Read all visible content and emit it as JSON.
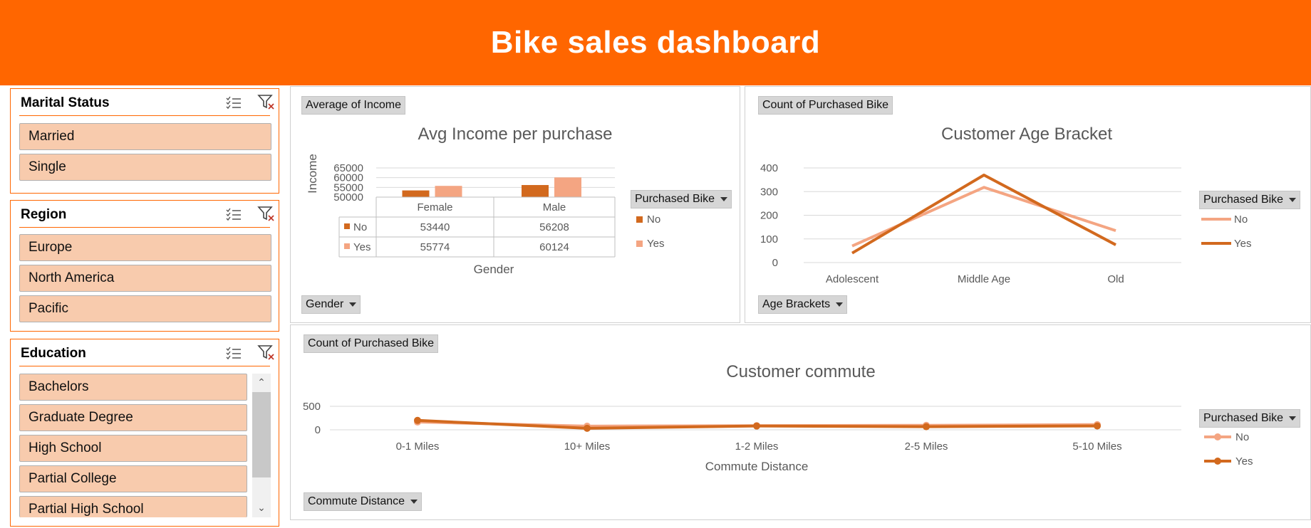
{
  "header": {
    "title": "Bike sales dashboard"
  },
  "colors": {
    "header": "#ff6600",
    "no": "#d2691e",
    "yes": "#f4a582",
    "slicer_item": "#f8cbad"
  },
  "slicers": [
    {
      "title": "Marital Status",
      "items": [
        "Married",
        "Single"
      ]
    },
    {
      "title": "Region",
      "items": [
        "Europe",
        "North America",
        "Pacific"
      ]
    },
    {
      "title": "Education",
      "items": [
        "Bachelors",
        "Graduate Degree",
        "High School",
        "Partial College",
        "Partial High School"
      ]
    }
  ],
  "income_panel": {
    "value_button": "Average of Income",
    "axis_button": "Gender",
    "legend_button": "Purchased Bike",
    "legend": [
      "No",
      "Yes"
    ],
    "table": {
      "headers": [
        "Female",
        "Male"
      ],
      "rows": [
        {
          "label": "No",
          "values": [
            "53440",
            "56208"
          ]
        },
        {
          "label": "Yes",
          "values": [
            "55774",
            "60124"
          ]
        }
      ]
    }
  },
  "age_panel": {
    "value_button": "Count of Purchased Bike",
    "axis_button": "Age Brackets",
    "legend_button": "Purchased Bike",
    "legend": [
      "No",
      "Yes"
    ]
  },
  "commute_panel": {
    "value_button": "Count of Purchased Bike",
    "axis_button": "Commute Distance",
    "legend_button": "Purchased Bike",
    "legend": [
      "No",
      "Yes"
    ]
  },
  "chart_data": [
    {
      "type": "bar",
      "title": "Avg Income per purchase",
      "xlabel": "Gender",
      "ylabel": "Income",
      "categories": [
        "Female",
        "Male"
      ],
      "yticks": [
        "65000",
        "60000",
        "55000",
        "50000"
      ],
      "ylim": [
        50000,
        65000
      ],
      "series": [
        {
          "name": "No",
          "values": [
            53440,
            56208
          ]
        },
        {
          "name": "Yes",
          "values": [
            55774,
            60124
          ]
        }
      ]
    },
    {
      "type": "line",
      "title": "Customer Age Bracket",
      "xlabel": "",
      "ylabel": "",
      "categories": [
        "Adolescent",
        "Middle Age",
        "Old"
      ],
      "yticks": [
        "400",
        "300",
        "200",
        "100",
        "0"
      ],
      "ylim": [
        0,
        400
      ],
      "series": [
        {
          "name": "No",
          "values": [
            70,
            318,
            135
          ]
        },
        {
          "name": "Yes",
          "values": [
            40,
            370,
            75
          ]
        }
      ]
    },
    {
      "type": "line",
      "title": "Customer commute",
      "xlabel": "Commute Distance",
      "ylabel": "",
      "categories": [
        "0-1 Miles",
        "10+ Miles",
        "1-2 Miles",
        "2-5 Miles",
        "5-10 Miles"
      ],
      "yticks": [
        "500",
        "0"
      ],
      "ylim": [
        0,
        500
      ],
      "series": [
        {
          "name": "No",
          "values": [
            166,
            78,
            88,
            95,
            110
          ]
        },
        {
          "name": "Yes",
          "values": [
            200,
            33,
            81,
            67,
            82
          ]
        }
      ]
    }
  ]
}
